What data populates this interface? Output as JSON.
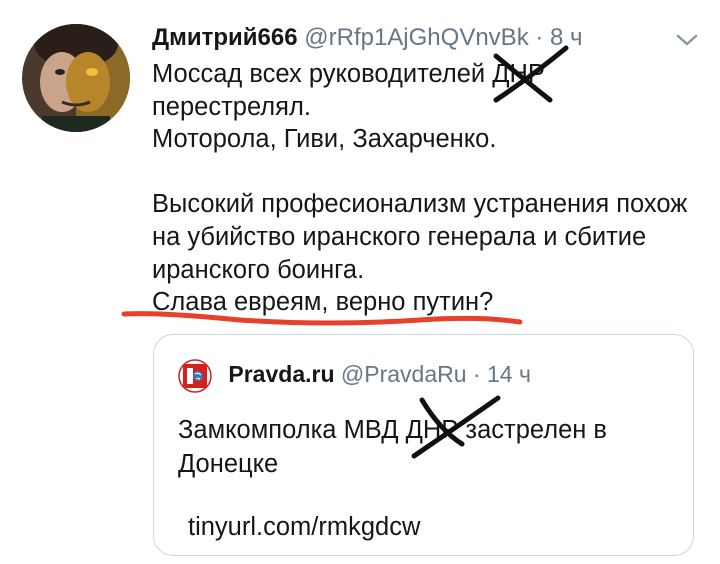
{
  "tweet": {
    "author_name": "Дмитрий666",
    "author_handle": "@rRfp1AjGhQVnvBk",
    "separator": "·",
    "time": "8 ч",
    "lines": [
      "Моссад всех руководителей ДНР",
      "перестрелял.",
      "Моторола, Гиви, Захарченко.",
      "",
      "Высокий професионализм устранения похож",
      "на убийство иранского генерала и сбитие",
      "иранского боинга.",
      "Слава евреям, верно путин?"
    ]
  },
  "quote": {
    "author_name": "Pravda.ru",
    "author_handle": "@PravdaRu",
    "separator": "·",
    "time": "14 ч",
    "text": "Замкомполка МВД ДНР застрелен в Донецке",
    "link": "tinyurl.com/rmkgdcw"
  },
  "icons": {
    "caret": "chevron-down-icon",
    "quote_logo": "pravda-logo"
  },
  "colors": {
    "text": "#14171a",
    "muted": "#657786",
    "border": "#ccd6dd",
    "underline": "#e8402a",
    "cross": "#111111",
    "logo_red": "#d3221c"
  }
}
